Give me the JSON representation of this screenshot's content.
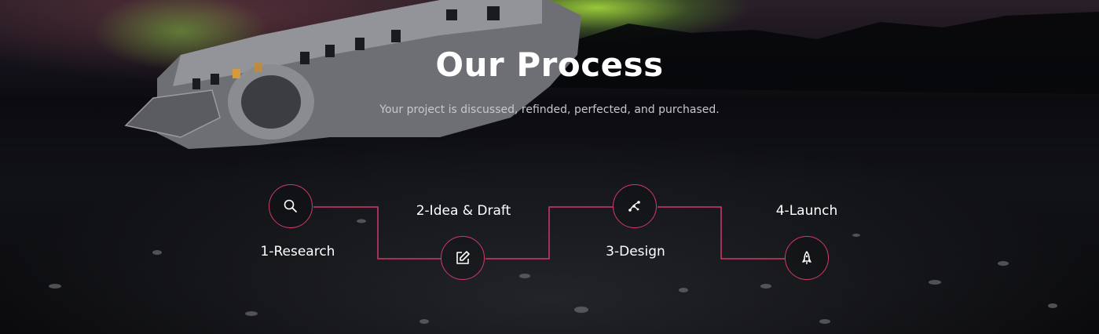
{
  "section": {
    "title": "Our Process",
    "subtitle": "Your project is discussed, refinded, perfected, and purchased."
  },
  "accent_color": "#d13a6b",
  "steps": [
    {
      "label": "1-Research",
      "icon": "search-icon"
    },
    {
      "label": "2-Idea & Draft",
      "icon": "edit-icon"
    },
    {
      "label": "3-Design",
      "icon": "vector-path-icon"
    },
    {
      "label": "4-Launch",
      "icon": "rocket-icon"
    }
  ]
}
